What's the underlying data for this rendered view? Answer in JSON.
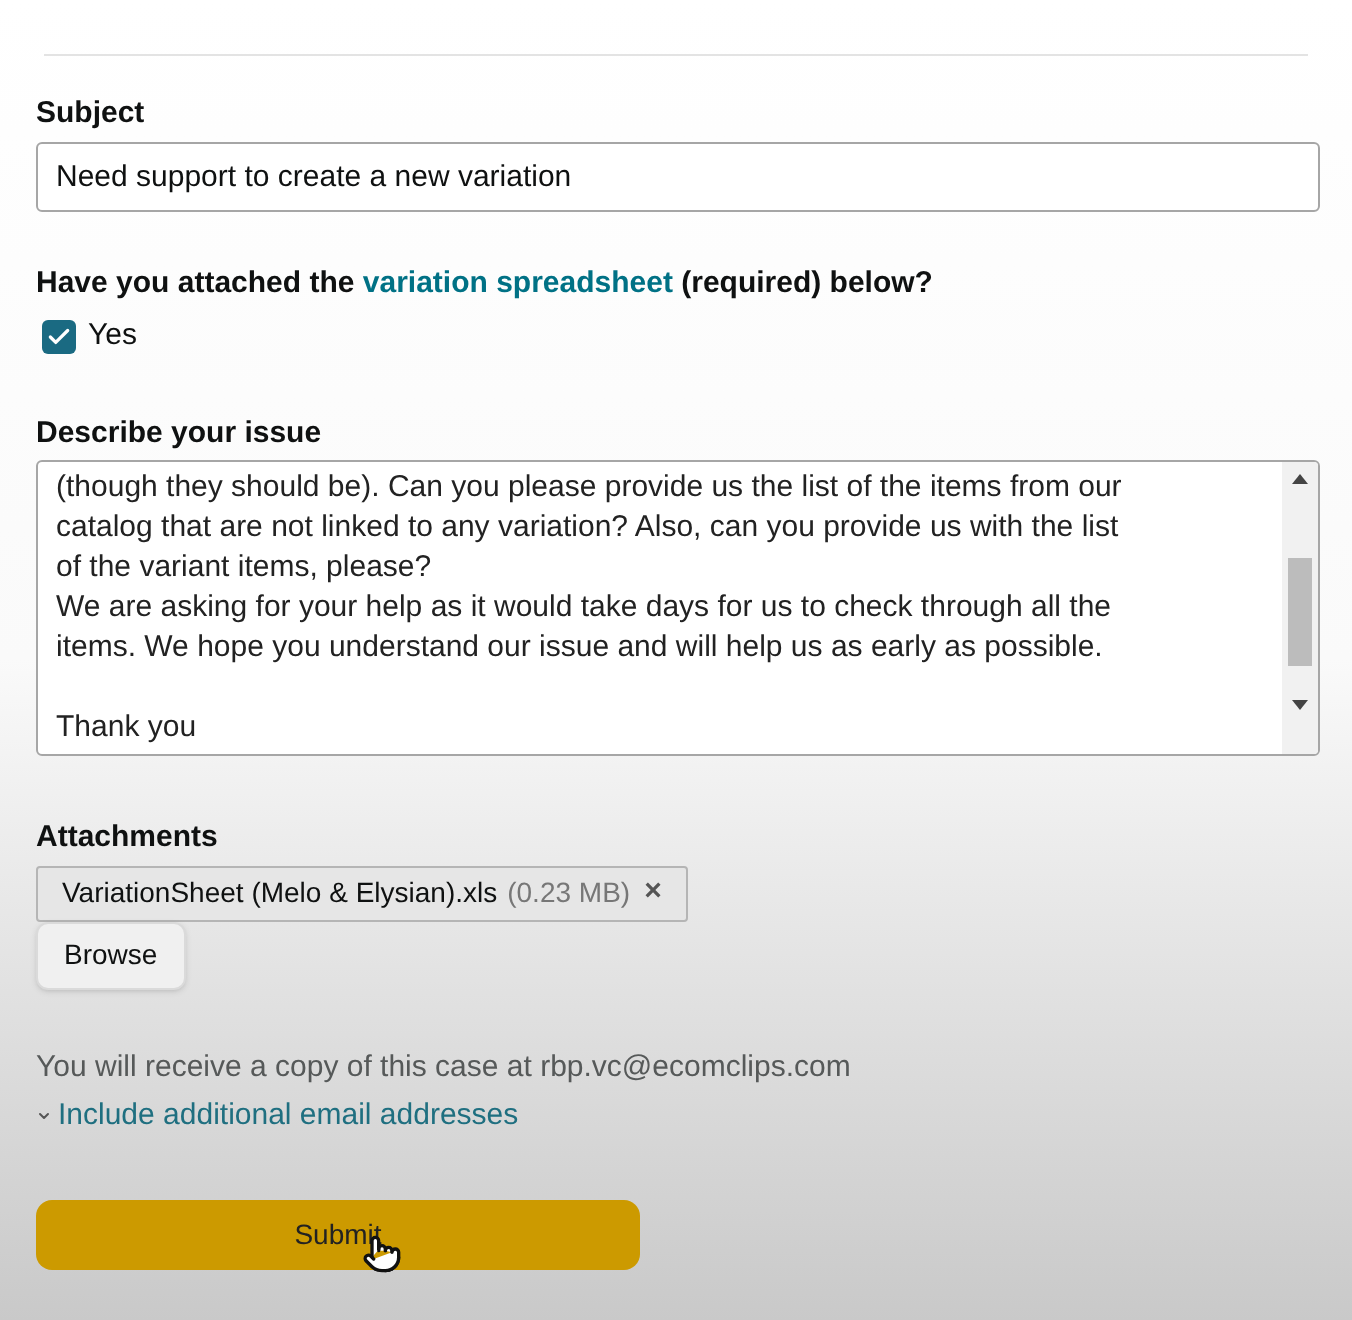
{
  "subject": {
    "label": "Subject",
    "value": "Need support to create a new variation"
  },
  "attached_question": {
    "before": "Have you attached the",
    "link": "variation spreadsheet",
    "after": "(required) below?"
  },
  "yes_checkbox": {
    "label": "Yes",
    "checked": true
  },
  "issue": {
    "label": "Describe your issue",
    "lines": [
      {
        "text": "(though they should be). Can you please provide us the list of the items from our",
        "gap_before": false
      },
      {
        "text": "catalog that are not linked to any variation? Also, can you provide us with the list",
        "gap_before": false
      },
      {
        "text": "of the variant items, please?",
        "gap_before": false
      },
      {
        "text": "We are asking for your help as it would take days for us to check through all the",
        "gap_before": false
      },
      {
        "text": "items. We hope you understand our issue and will help us as early as possible.",
        "gap_before": false
      },
      {
        "text": "Thank you",
        "gap_before": true
      }
    ]
  },
  "attachments": {
    "label": "Attachments",
    "files": [
      {
        "name": "VariationSheet (Melo & Elysian).xls",
        "size": "(0.23 MB)",
        "remove": "×"
      }
    ],
    "browse": "Browse"
  },
  "copy_notice": "You will receive a copy of this case at rbp.vc@ecomclips.com",
  "include_link": {
    "label": "Include additional email addresses",
    "expanded": false
  },
  "submit": "Submit"
}
